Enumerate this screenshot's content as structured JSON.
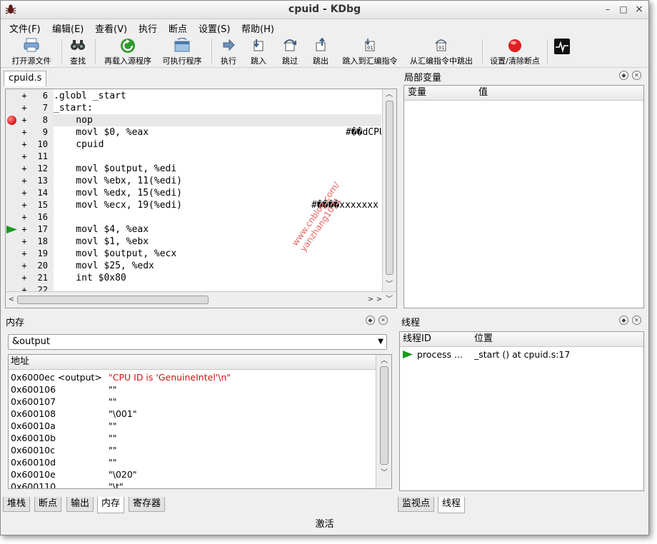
{
  "window": {
    "title": "cpuid - KDbg",
    "min": "–",
    "max": "□",
    "close": "×"
  },
  "menubar": [
    {
      "label": "文件(F)"
    },
    {
      "label": "编辑(E)"
    },
    {
      "label": "查看(V)"
    },
    {
      "label": "执行"
    },
    {
      "label": "断点"
    },
    {
      "label": "设置(S)"
    },
    {
      "label": "帮助(H)"
    }
  ],
  "toolbar": {
    "open_source": "打开源文件",
    "find": "查找",
    "reload_source": "再载入源程序",
    "executable": "可执行程序",
    "run": "执行",
    "step_into": "跳入",
    "step_over": "跳过",
    "step_out": "跳出",
    "step_into_asm": "跳入到汇编指令",
    "step_out_asm": "从汇编指令中跳出",
    "toggle_breakpoint": "设置/清除断点"
  },
  "editor": {
    "tab": "cpuid.s",
    "lines": [
      {
        "n": "6",
        "text": ".globl _start",
        "comment": ""
      },
      {
        "n": "7",
        "text": "_start:",
        "comment": ""
      },
      {
        "n": "8",
        "text": "    nop",
        "comment": "",
        "breakpoint": true,
        "highlight": true
      },
      {
        "n": "9",
        "text": "    movl $0, %eax",
        "comment": "#��dCPU"
      },
      {
        "n": "10",
        "text": "    cpuid",
        "comment": ""
      },
      {
        "n": "11",
        "text": "",
        "comment": ""
      },
      {
        "n": "12",
        "text": "    movl $output, %edi",
        "comment": ""
      },
      {
        "n": "13",
        "text": "    movl %ebx, 11(%edi)",
        "comment": ""
      },
      {
        "n": "14",
        "text": "    movl %edx, 15(%edi)",
        "comment": ""
      },
      {
        "n": "15",
        "text": "    movl %ecx, 19(%edi)",
        "comment": "#����xxxxxxx"
      },
      {
        "n": "16",
        "text": "",
        "comment": ""
      },
      {
        "n": "17",
        "text": "    movl $4, %eax",
        "comment": "",
        "current": true
      },
      {
        "n": "18",
        "text": "    movl $1, %ebx",
        "comment": ""
      },
      {
        "n": "19",
        "text": "    movl $output, %ecx",
        "comment": ""
      },
      {
        "n": "20",
        "text": "    movl $25, %edx",
        "comment": ""
      },
      {
        "n": "21",
        "text": "    int $0x80",
        "comment": ""
      },
      {
        "n": "22",
        "text": "",
        "comment": ""
      }
    ]
  },
  "locals": {
    "title": "局部变量",
    "col_var": "变量",
    "col_value": "值"
  },
  "memory": {
    "title": "内存",
    "expression": "&output",
    "col_address": "地址",
    "rows": [
      {
        "addr": "0x6000ec <output>",
        "val": "\"CPU ID is 'GenuineIntel'\\n\"",
        "changed": true
      },
      {
        "addr": "0x600106",
        "val": "\"\""
      },
      {
        "addr": "0x600107",
        "val": "\"\""
      },
      {
        "addr": "0x600108",
        "val": "\"\\001\""
      },
      {
        "addr": "0x60010a",
        "val": "\"\""
      },
      {
        "addr": "0x60010b",
        "val": "\"\""
      },
      {
        "addr": "0x60010c",
        "val": "\"\""
      },
      {
        "addr": "0x60010d",
        "val": "\"\""
      },
      {
        "addr": "0x60010e",
        "val": "\"\\020\""
      },
      {
        "addr": "0x600110",
        "val": "\"\\t\""
      }
    ],
    "tabs": [
      "堆栈",
      "断点",
      "输出",
      "内存",
      "寄存器"
    ],
    "active_tab": 3
  },
  "threads": {
    "title": "线程",
    "col_id": "线程ID",
    "col_location": "位置",
    "rows": [
      {
        "id": "process ...",
        "location": "_start () at cpuid.s:17"
      }
    ],
    "tabs": [
      "监视点",
      "线程"
    ],
    "active_tab": 1
  },
  "status": "激活",
  "watermark": [
    "www.cnblog.com/",
    "yanzhang1031"
  ],
  "colors": {
    "breakpoint": "#e02020",
    "current_line": "#1a9a1a",
    "changed_value": "#d01010"
  }
}
